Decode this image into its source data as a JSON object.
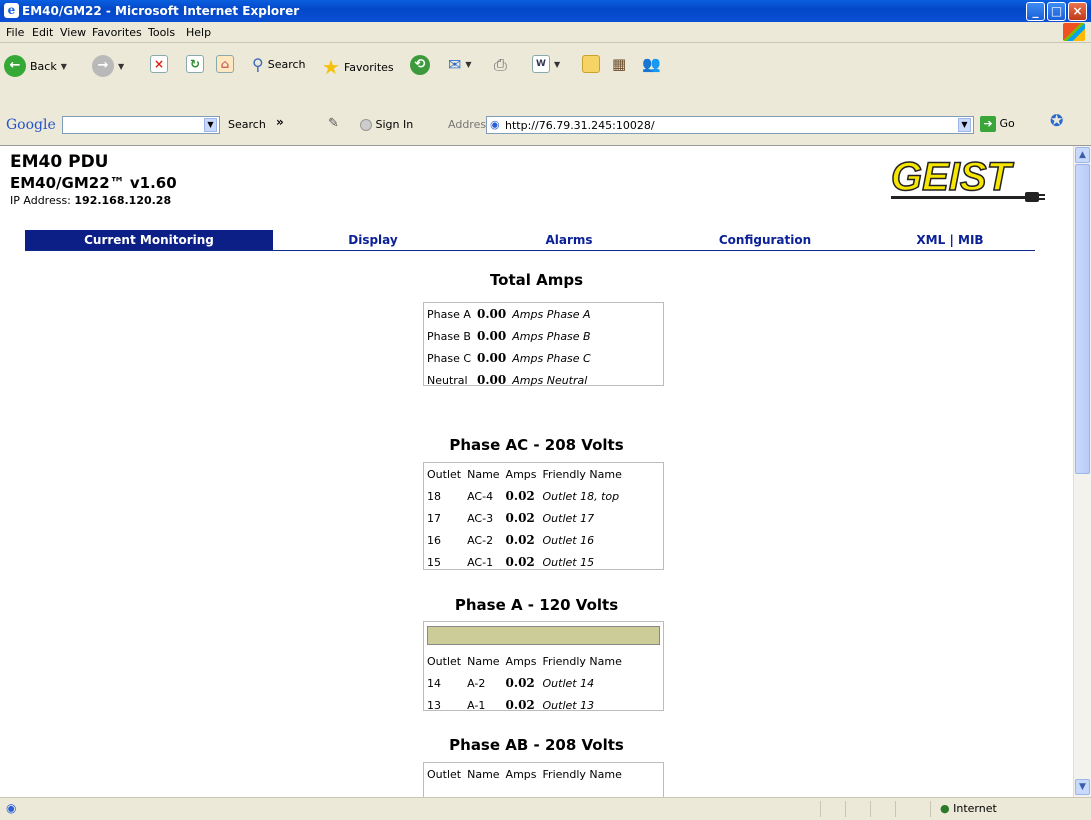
{
  "window": {
    "title": "EM40/GM22 - Microsoft Internet Explorer"
  },
  "menu": [
    "File",
    "Edit",
    "View",
    "Favorites",
    "Tools",
    "Help"
  ],
  "toolbar": {
    "back": "Back",
    "search": "Search",
    "favorites": "Favorites"
  },
  "google": {
    "logo": "Google",
    "search": "Search",
    "more": "»",
    "signin": "Sign In"
  },
  "address": {
    "label": "Address",
    "url": "http://76.79.31.245:10028/",
    "go": "Go"
  },
  "page": {
    "title": "EM40 PDU",
    "subtitle": "EM40/GM22™ v1.60",
    "ip_label": "IP Address:",
    "ip_value": "192.168.120.28",
    "logo": "GEIST"
  },
  "nav": [
    {
      "label": "Current Monitoring",
      "active": true
    },
    {
      "label": "Display",
      "active": false
    },
    {
      "label": "Alarms",
      "active": false
    },
    {
      "label": "Configuration",
      "active": false
    },
    {
      "label": "XML | MIB",
      "active": false
    }
  ],
  "total_amps": {
    "title": "Total Amps",
    "rows": [
      {
        "phase": "Phase A",
        "value": "0.00",
        "desc": "Amps Phase A"
      },
      {
        "phase": "Phase B",
        "value": "0.00",
        "desc": "Amps Phase B"
      },
      {
        "phase": "Phase C",
        "value": "0.00",
        "desc": "Amps Phase C"
      },
      {
        "phase": "Neutral",
        "value": "0.00",
        "desc": "Amps Neutral"
      }
    ]
  },
  "columns": {
    "outlet": "Outlet",
    "name": "Name",
    "amps": "Amps",
    "friendly": "Friendly Name"
  },
  "phase_ac": {
    "title": "Phase AC - 208 Volts",
    "rows": [
      {
        "outlet": "18",
        "name": "AC-4",
        "amps": "0.02",
        "friendly": "Outlet 18, top"
      },
      {
        "outlet": "17",
        "name": "AC-3",
        "amps": "0.02",
        "friendly": "Outlet 17"
      },
      {
        "outlet": "16",
        "name": "AC-2",
        "amps": "0.02",
        "friendly": "Outlet 16"
      },
      {
        "outlet": "15",
        "name": "AC-1",
        "amps": "0.02",
        "friendly": "Outlet 15"
      }
    ]
  },
  "phase_a": {
    "title": "Phase A - 120 Volts",
    "rows": [
      {
        "outlet": "14",
        "name": "A-2",
        "amps": "0.02",
        "friendly": "Outlet 14"
      },
      {
        "outlet": "13",
        "name": "A-1",
        "amps": "0.02",
        "friendly": "Outlet 13"
      }
    ]
  },
  "phase_ab": {
    "title": "Phase AB - 208 Volts"
  },
  "status": {
    "zone": "Internet"
  }
}
